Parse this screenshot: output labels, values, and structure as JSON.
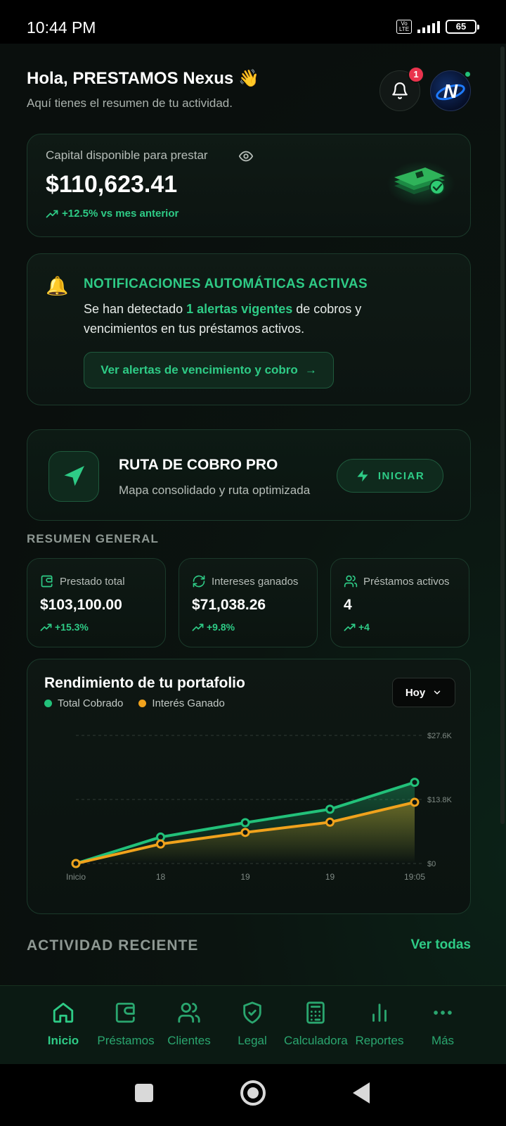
{
  "status_bar": {
    "time": "10:44 PM",
    "volte": "Vo LTE",
    "battery": "65"
  },
  "header": {
    "greeting": "Hola, PRESTAMOS Nexus 👋",
    "subtitle": "Aquí tienes el resumen de tu actividad.",
    "notification_count": "1",
    "avatar_letter": "N"
  },
  "capital": {
    "label": "Capital disponible para prestar",
    "amount": "$110,623.41",
    "trend": "+12.5% vs mes anterior"
  },
  "notifications": {
    "title": "NOTIFICACIONES AUTOMÁTICAS ACTIVAS",
    "text_before": "Se han detectado ",
    "text_highlight": "1 alertas vigentes",
    "text_after": " de cobros y vencimientos en tus préstamos activos.",
    "button_label": "Ver alertas de vencimiento y cobro",
    "button_arrow": "→"
  },
  "route": {
    "title": "RUTA DE COBRO PRO",
    "subtitle": "Mapa consolidado y ruta optimizada",
    "button_label": "INICIAR"
  },
  "summary": {
    "title": "RESUMEN GENERAL",
    "cards": [
      {
        "label": "Prestado total",
        "value": "$103,100.00",
        "trend": "+15.3%",
        "icon": "wallet-icon"
      },
      {
        "label": "Intereses ganados",
        "value": "$71,038.26",
        "trend": "+9.8%",
        "icon": "refresh-icon"
      },
      {
        "label": "Préstamos activos",
        "value": "4",
        "trend": "+4",
        "icon": "users-icon"
      }
    ]
  },
  "portfolio": {
    "title": "Rendimiento de tu portafolio",
    "period": "Hoy",
    "colors": {
      "cobrado": "#22c17a",
      "interes": "#f0a21c"
    }
  },
  "chart_data": {
    "type": "area",
    "categories": [
      "Inicio",
      "18",
      "19",
      "19",
      "19:05"
    ],
    "series": [
      {
        "name": "Total Cobrado",
        "values": [
          0,
          5700,
          8800,
          11700,
          17500
        ]
      },
      {
        "name": "Interés Ganado",
        "values": [
          0,
          4200,
          6700,
          8900,
          13200
        ]
      }
    ],
    "y_ticks": [
      "$0",
      "$13.8K",
      "$27.6K"
    ],
    "ylim": [
      0,
      27600
    ],
    "ylabel": "",
    "xlabel": "",
    "grid": true,
    "legend": "top-left"
  },
  "activity": {
    "title": "ACTIVIDAD RECIENTE",
    "link": "Ver todas"
  },
  "bottom_nav": [
    {
      "label": "Inicio",
      "icon": "home-icon",
      "active": true
    },
    {
      "label": "Préstamos",
      "icon": "wallet-icon"
    },
    {
      "label": "Clientes",
      "icon": "users-icon"
    },
    {
      "label": "Legal",
      "icon": "shield-icon"
    },
    {
      "label": "Calculadora",
      "icon": "calculator-icon"
    },
    {
      "label": "Reportes",
      "icon": "bar-chart-icon"
    },
    {
      "label": "Más",
      "icon": "more-icon"
    }
  ]
}
